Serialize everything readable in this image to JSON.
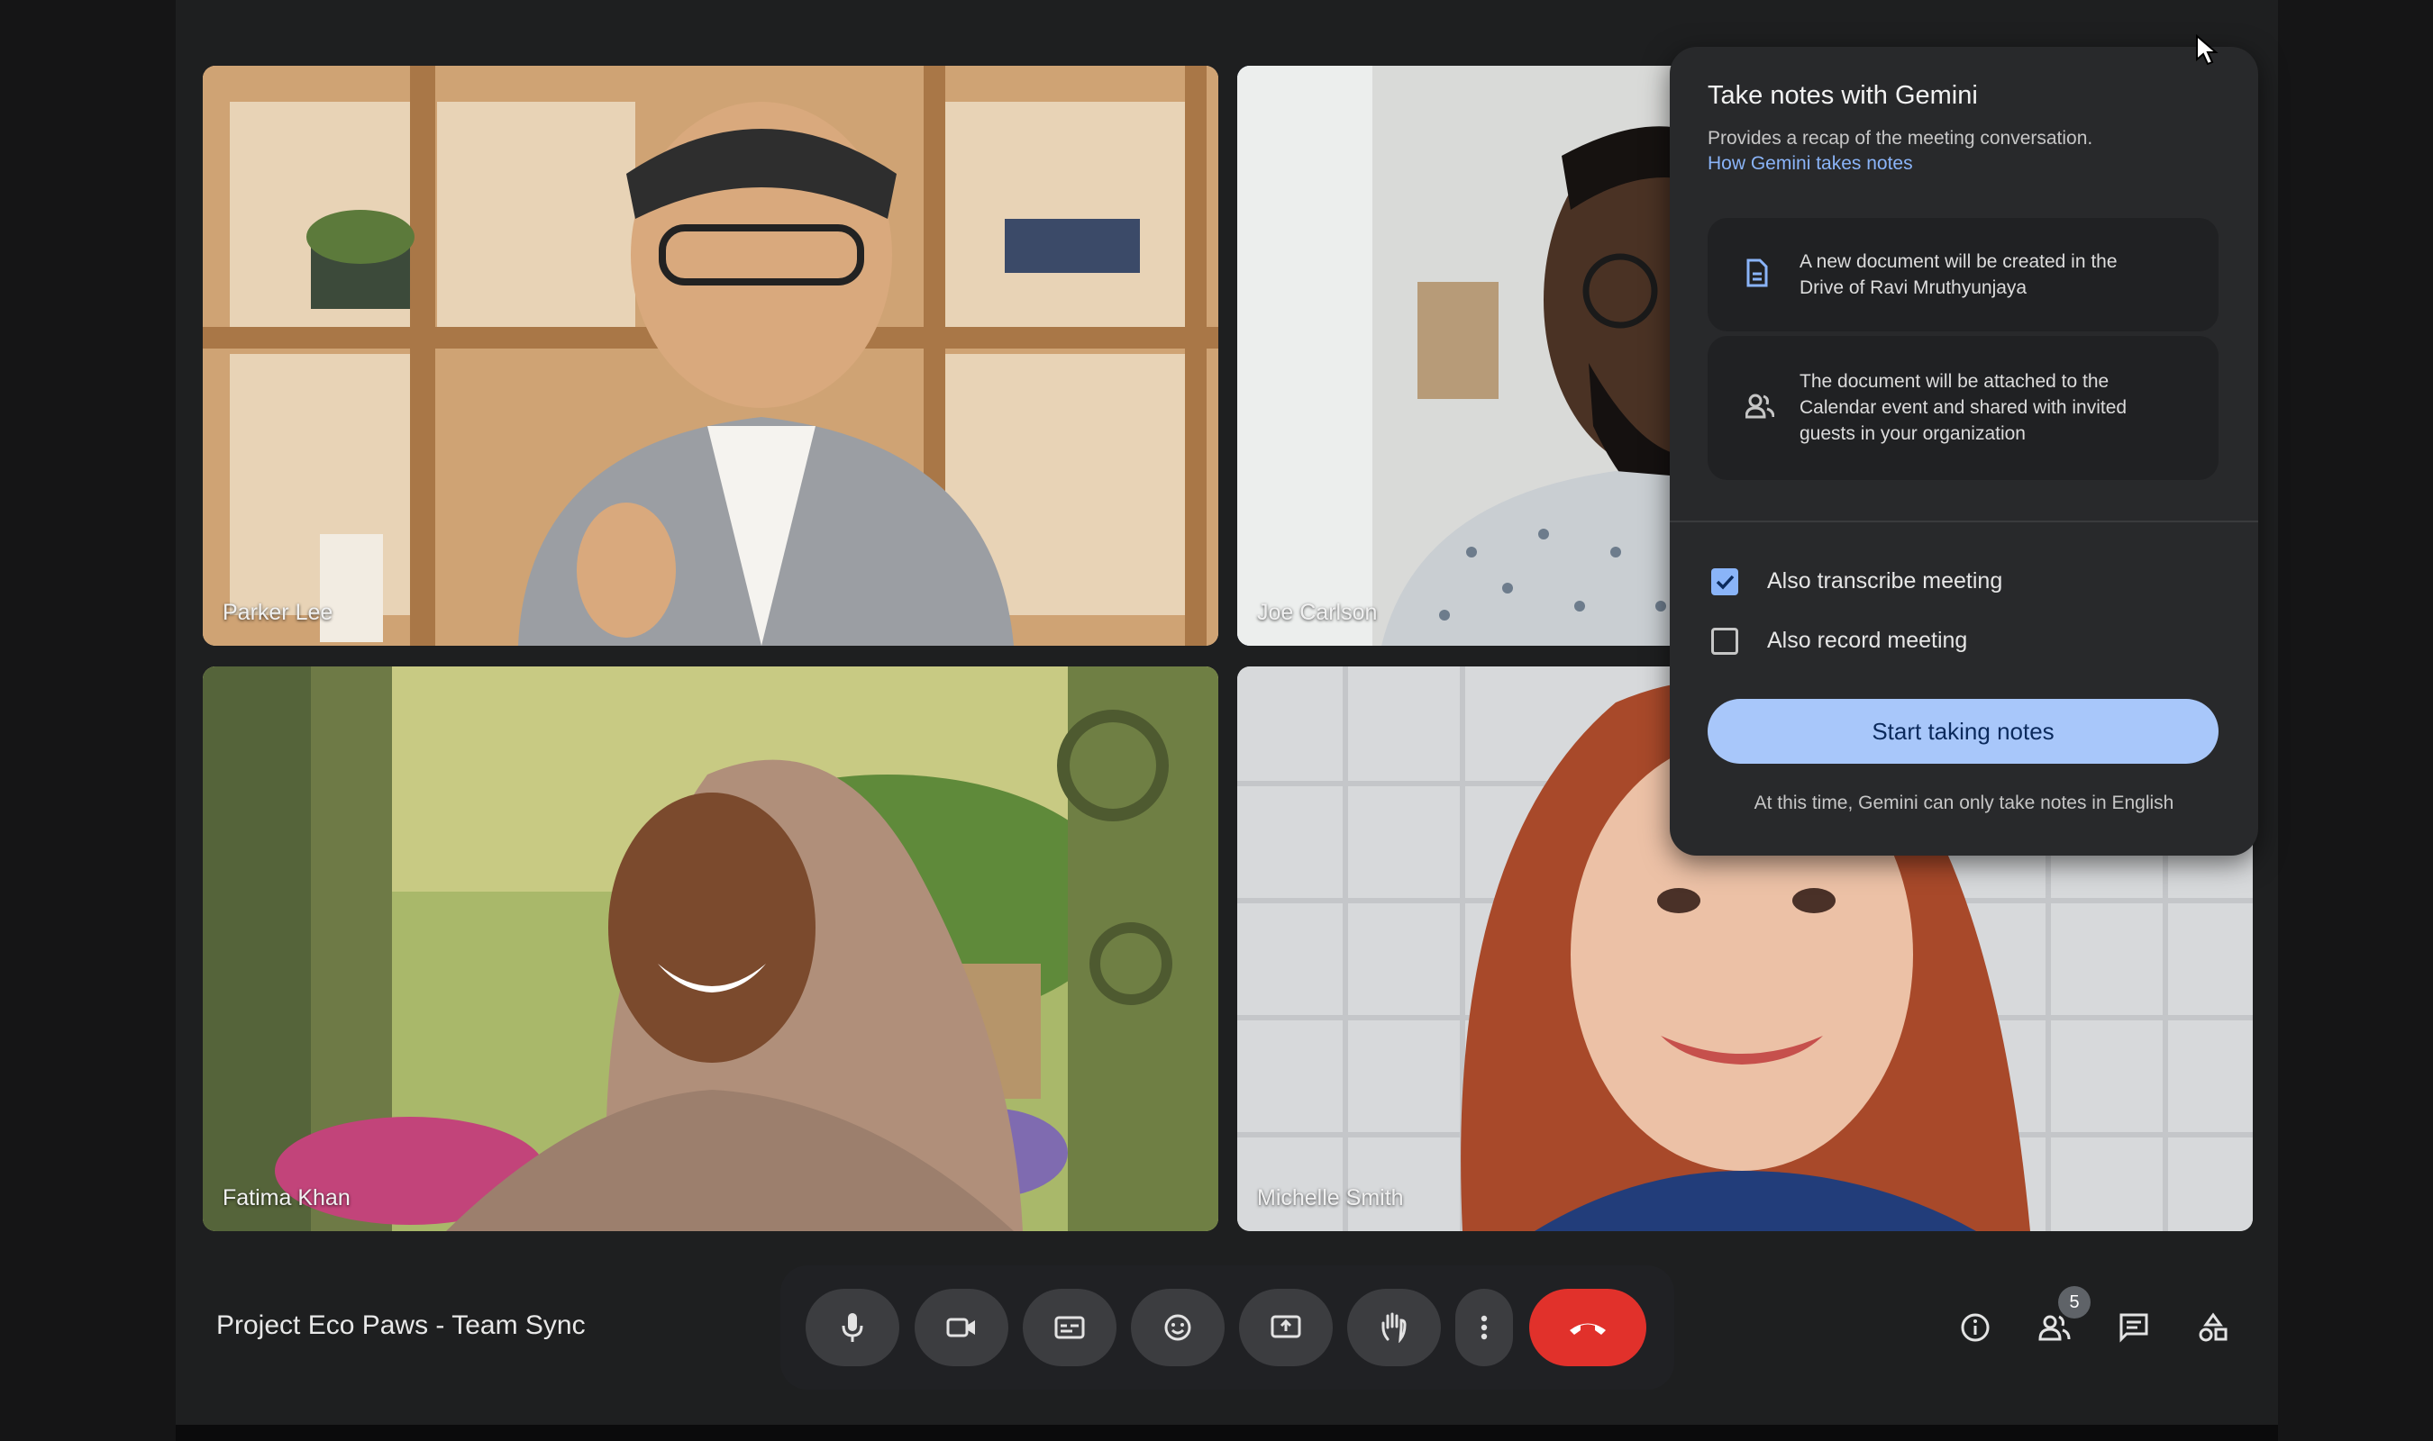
{
  "participants": [
    {
      "name": "Parker Lee"
    },
    {
      "name": "Joe Carlson"
    },
    {
      "name": "Fatima Khan"
    },
    {
      "name": "Michelle Smith"
    }
  ],
  "panel": {
    "title": "Take notes with Gemini",
    "description": "Provides a recap of the meeting conversation.",
    "link": "How Gemini takes notes",
    "info": [
      {
        "icon": "document-icon",
        "lines": [
          "A new document will be created in the",
          "Drive of Ravi Mruthyunjaya"
        ]
      },
      {
        "icon": "people-icon",
        "lines": [
          "The document will be attached to the",
          "Calendar event and shared with invited",
          "guests in your organization"
        ]
      }
    ],
    "options": [
      {
        "label": "Also transcribe meeting",
        "checked": true
      },
      {
        "label": "Also record meeting",
        "checked": false
      }
    ],
    "start_button": "Start taking notes",
    "footer": "At this time, Gemini can only take notes in English"
  },
  "meeting": {
    "title": "Project Eco Paws - Team Sync",
    "participant_count": "5"
  },
  "controls": [
    {
      "icon": "microphone-icon"
    },
    {
      "icon": "camera-icon"
    },
    {
      "icon": "captions-icon"
    },
    {
      "icon": "emoji-icon"
    },
    {
      "icon": "present-screen-icon"
    },
    {
      "icon": "raise-hand-icon"
    },
    {
      "icon": "more-options-icon"
    },
    {
      "icon": "end-call-icon"
    }
  ],
  "right_controls": [
    {
      "icon": "info-icon"
    },
    {
      "icon": "people-icon"
    },
    {
      "icon": "chat-icon"
    },
    {
      "icon": "activities-icon"
    }
  ],
  "colors": {
    "accent": "#8ab4f8",
    "end_call": "#e1312b",
    "panel_bg": "#28292b",
    "button": "#a8c7fa"
  }
}
